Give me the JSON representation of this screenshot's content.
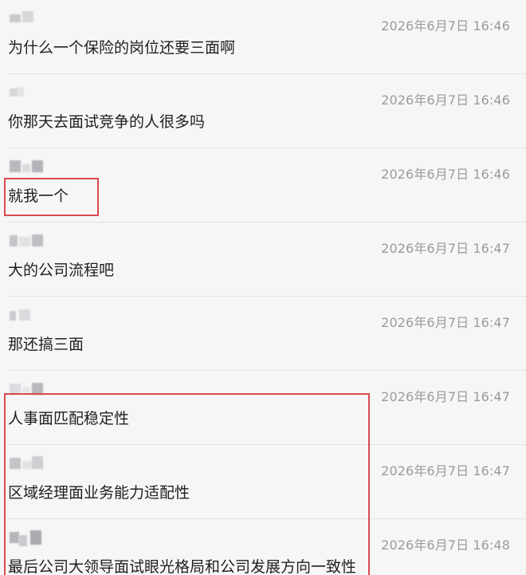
{
  "messages": [
    {
      "time": "2026年6月7日 16:46",
      "text": "为什么一个保险的岗位还要三面啊"
    },
    {
      "time": "2026年6月7日 16:46",
      "text": "你那天去面试竞争的人很多吗"
    },
    {
      "time": "2026年6月7日 16:46",
      "text": "就我一个"
    },
    {
      "time": "2026年6月7日 16:47",
      "text": "大的公司流程吧"
    },
    {
      "time": "2026年6月7日 16:47",
      "text": "那还搞三面"
    },
    {
      "time": "2026年6月7日 16:47",
      "text": "人事面匹配稳定性"
    },
    {
      "time": "2026年6月7日 16:47",
      "text": "区域经理面业务能力适配性"
    },
    {
      "time": "2026年6月7日 16:48",
      "text": "最后公司大领导面试眼光格局和公司发展方向一致性"
    }
  ],
  "colors": {
    "background": "#f6f6f6",
    "timestamp": "#9b9b9b",
    "message_text": "#1f1f1f",
    "highlight_border": "#d9494d"
  }
}
